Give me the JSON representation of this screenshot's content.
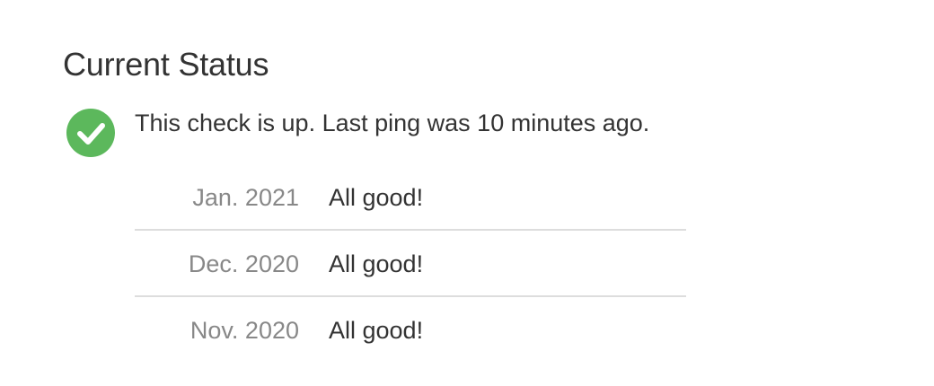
{
  "section": {
    "title": "Current Status"
  },
  "status": {
    "icon": "check-circle-icon",
    "color": "#5cb85c",
    "text": "This check is up. Last ping was 10 minutes ago."
  },
  "events": [
    {
      "date": "Jan. 2021",
      "text": "All good!"
    },
    {
      "date": "Dec. 2020",
      "text": "All good!"
    },
    {
      "date": "Nov. 2020",
      "text": "All good!"
    }
  ]
}
